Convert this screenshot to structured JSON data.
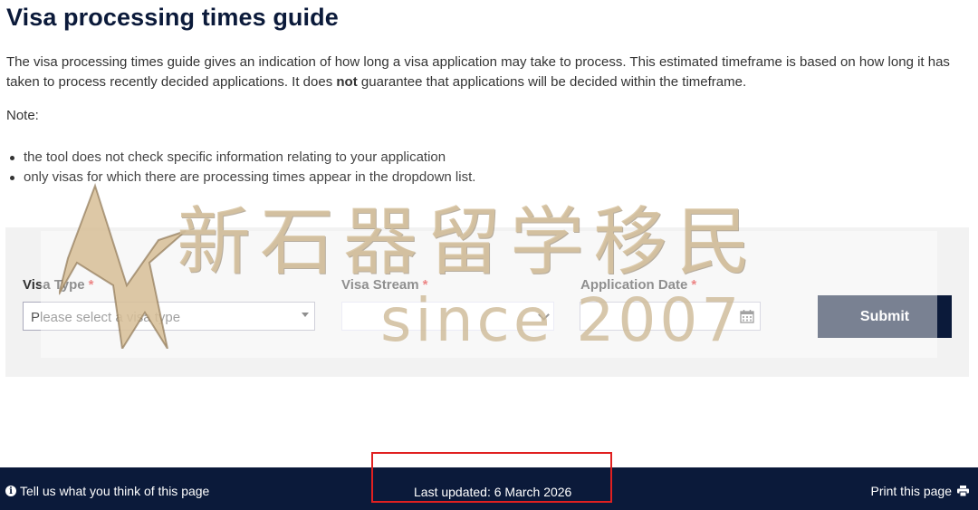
{
  "page": {
    "title": "Visa processing times guide",
    "intro_before": "The visa processing times guide gives an indication of how long a visa application may take to process. This estimated timeframe is based on how long it has taken to process recently decided applications. It does ",
    "intro_bold": "not",
    "intro_after": " guarantee that applications will be decided within the timeframe.",
    "note_label": "Note:",
    "notes": [
      "the tool does not check specific information relating to your application",
      "only visas for which there are processing times appear in the dropdown list."
    ]
  },
  "form": {
    "visa_type_label": "Visa Type",
    "visa_stream_label": "Visa Stream",
    "application_date_label": "Application Date",
    "required_marker": "*",
    "visa_type_placeholder": "Please select a visa type",
    "visa_stream_value": "",
    "application_date_value": "",
    "submit_label": "Submit"
  },
  "watermark": {
    "chinese": "新石器留学移民",
    "since": "since 2007"
  },
  "footer": {
    "feedback_text": "Tell us what you think of this page",
    "last_updated": "Last updated: 6 March 2026",
    "print_text": "Print this page"
  },
  "colors": {
    "navy": "#0b1a3a",
    "required": "#dd2222",
    "highlight": "#e02020",
    "panel": "#f2f2f2"
  },
  "icons": [
    "caret-down-icon",
    "chevron-down-icon",
    "calendar-icon",
    "info-icon",
    "print-icon"
  ]
}
